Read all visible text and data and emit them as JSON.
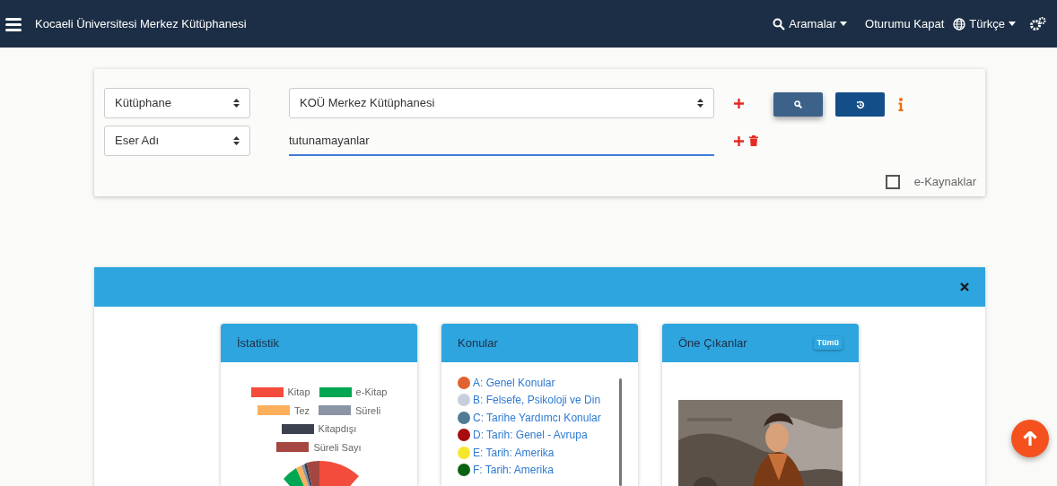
{
  "navbar": {
    "title": "Kocaeli Üniversitesi Merkez Kütüphanesi",
    "searches": "Aramalar",
    "logout": "Oturumu Kapat",
    "language": "Türkçe"
  },
  "search": {
    "rows": [
      {
        "field": "Kütüphane",
        "kind": "select",
        "value": "KOÜ Merkez Kütüphanesi"
      },
      {
        "field": "Eser Adı",
        "kind": "text",
        "value": "tutunamayanlar"
      }
    ],
    "eresources": {
      "label": "e-Kaynaklar",
      "checked": false
    }
  },
  "cards": [
    {
      "title": "İstatistik",
      "kind": "stats",
      "legend": [
        {
          "label": "Kitap",
          "color": "#f44c3c"
        },
        {
          "label": "e-Kitap",
          "color": "#00a651"
        },
        {
          "label": "Tez",
          "color": "#fbb05c"
        },
        {
          "label": "Süreli",
          "color": "#8c95a6"
        },
        {
          "label": "Kitapdışı",
          "color": "#3d4250"
        },
        {
          "label": "Süreli Sayı",
          "color": "#a54640"
        }
      ]
    },
    {
      "title": "Konular",
      "kind": "subjects",
      "items": [
        {
          "label": "A: Genel Konular",
          "color": "#e0622e"
        },
        {
          "label": "B: Felsefe, Psikoloji ve Din",
          "color": "#c8cfdc"
        },
        {
          "label": "C: Tarihe Yardımcı Konular",
          "color": "#4f7c94"
        },
        {
          "label": "D: Tarih: Genel - Avrupa",
          "color": "#a80d0d"
        },
        {
          "label": "E: Tarih: Amerika",
          "color": "#f7e72c"
        },
        {
          "label": "F: Tarih: Amerika",
          "color": "#0b6312"
        }
      ]
    },
    {
      "title": "Öne Çıkanlar",
      "kind": "featured",
      "badge": "Tümü"
    }
  ]
}
